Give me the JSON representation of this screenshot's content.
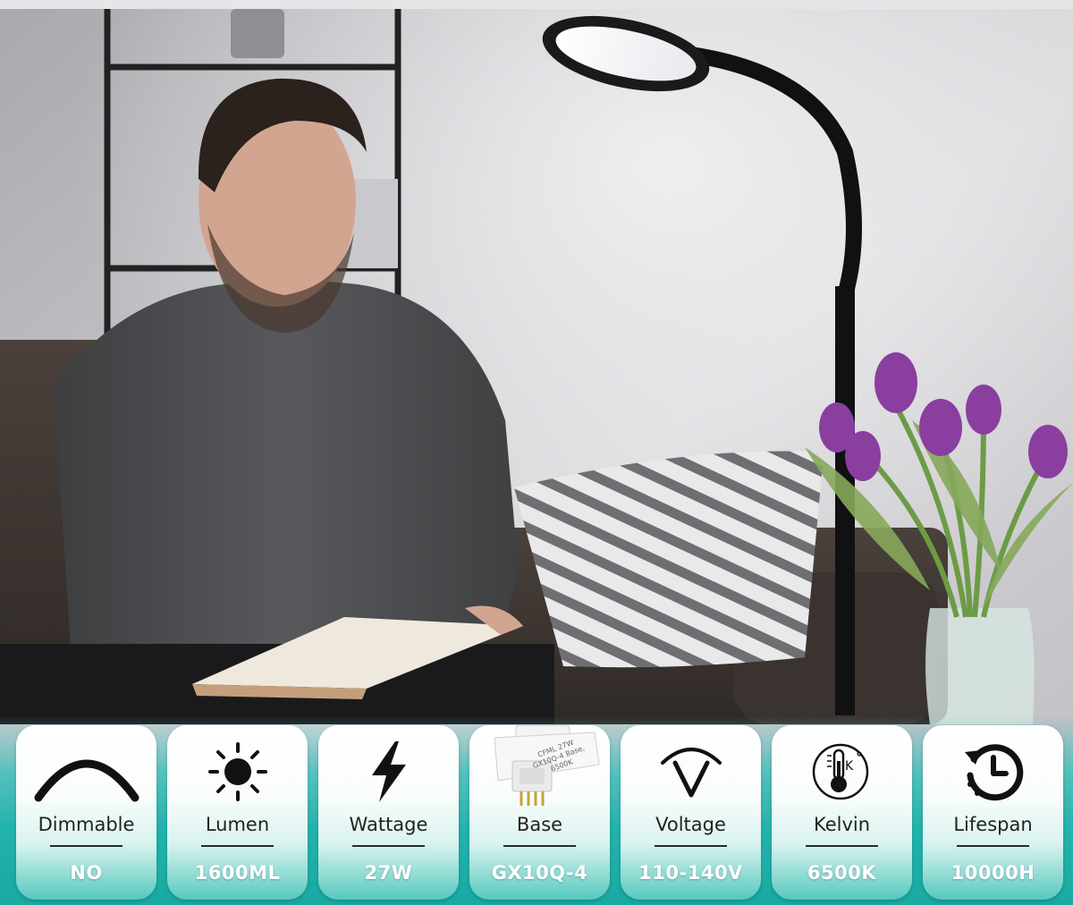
{
  "specs": [
    {
      "label": "Dimmable",
      "value": "NO",
      "icon": "dimmer-arc-icon"
    },
    {
      "label": "Lumen",
      "value": "1600ML",
      "icon": "sun-icon"
    },
    {
      "label": "Wattage",
      "value": "27W",
      "icon": "lightning-bolt-icon"
    },
    {
      "label": "Base",
      "value": "GX10Q-4",
      "icon": "bulb-base-photo"
    },
    {
      "label": "Voltage",
      "value": "110-140V",
      "icon": "voltage-gauge-icon"
    },
    {
      "label": "Kelvin",
      "value": "6500K",
      "icon": "thermometer-kelvin-icon"
    },
    {
      "label": "Lifespan",
      "value": "10000H",
      "icon": "history-clock-icon"
    }
  ],
  "bulb_print": {
    "line1": "CFML 27W",
    "line2": "GX10Q-4 Base, 6500K"
  },
  "colors": {
    "accent": "#22b3ad",
    "card_top": "#ffffff",
    "text": "#222222"
  }
}
